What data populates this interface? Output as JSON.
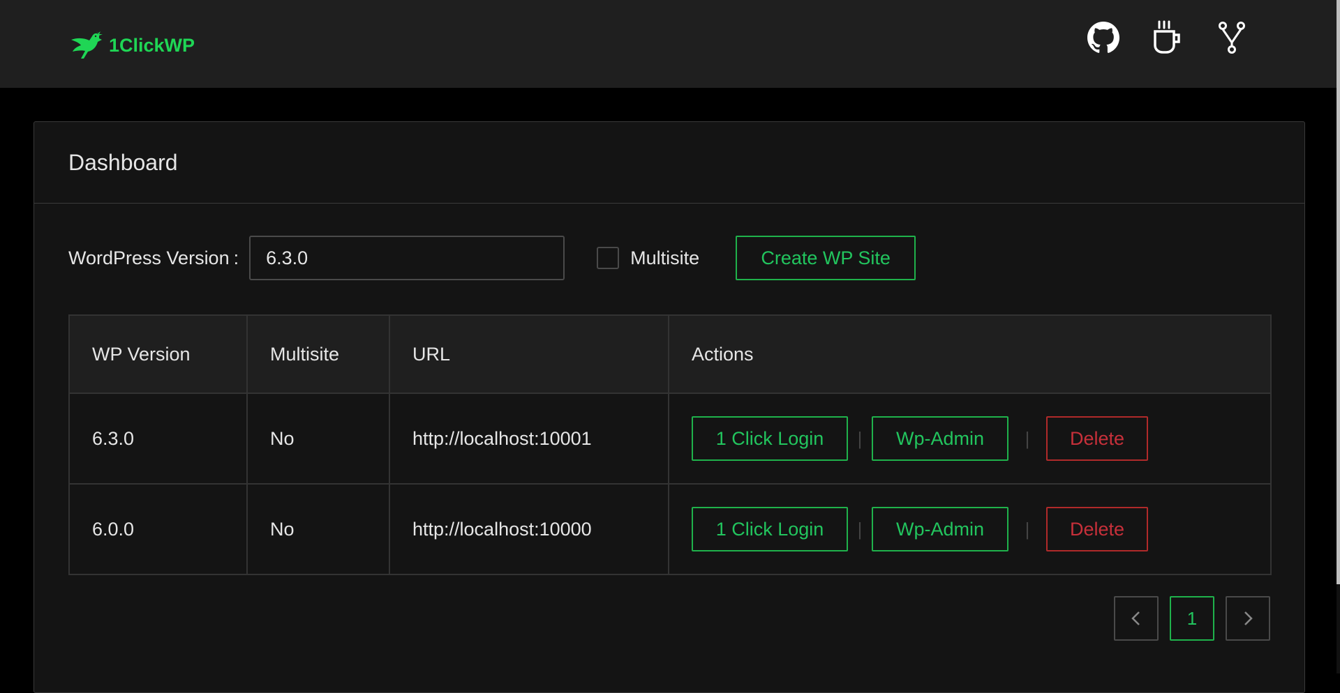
{
  "brand": {
    "name": "1ClickWP",
    "icon": "bird-icon"
  },
  "nav": {
    "icons": [
      "github-icon",
      "coffee-icon",
      "fork-icon"
    ]
  },
  "card": {
    "title": "Dashboard"
  },
  "form": {
    "version_label": "WordPress Version",
    "colon": ":",
    "version_value": "6.3.0",
    "multisite_label": "Multisite",
    "multisite_checked": false,
    "create_label": "Create WP Site"
  },
  "table": {
    "headers": {
      "version": "WP Version",
      "multisite": "Multisite",
      "url": "URL",
      "actions": "Actions"
    },
    "rows": [
      {
        "version": "6.3.0",
        "multisite": "No",
        "url": "http://localhost:10001"
      },
      {
        "version": "6.0.0",
        "multisite": "No",
        "url": "http://localhost:10000"
      }
    ],
    "actions": {
      "login_label": "1 Click Login",
      "admin_label": "Wp-Admin",
      "delete_label": "Delete",
      "separator": "|"
    }
  },
  "pagination": {
    "prev_icon": "chevron-left-icon",
    "current_page": "1",
    "next_icon": "chevron-right-icon"
  },
  "colors": {
    "accent_green": "#22c55e",
    "danger_red": "#c7303a",
    "header_bg": "#1f1f1f",
    "card_bg": "#141414"
  }
}
